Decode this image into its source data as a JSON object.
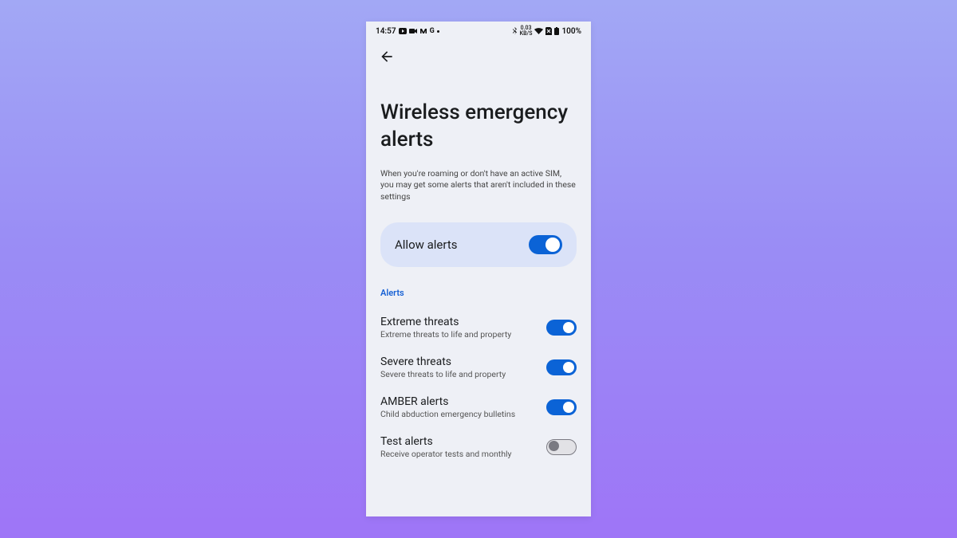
{
  "status": {
    "time": "14:57",
    "net_rate_top": "0.03",
    "net_rate_bottom": "KB/S",
    "battery": "100%"
  },
  "page": {
    "title": "Wireless emergency alerts",
    "subtitle": "When you're roaming or don't have an active SIM, you may get some alerts that aren't included in these settings"
  },
  "master": {
    "label": "Allow alerts",
    "on": true
  },
  "section_header": "Alerts",
  "settings": [
    {
      "title": "Extreme threats",
      "sub": "Extreme threats to life and property",
      "on": true
    },
    {
      "title": "Severe threats",
      "sub": "Severe threats to life and property",
      "on": true
    },
    {
      "title": "AMBER alerts",
      "sub": "Child abduction emergency bulletins",
      "on": true
    },
    {
      "title": "Test alerts",
      "sub": "Receive operator tests and monthly",
      "on": false
    }
  ]
}
